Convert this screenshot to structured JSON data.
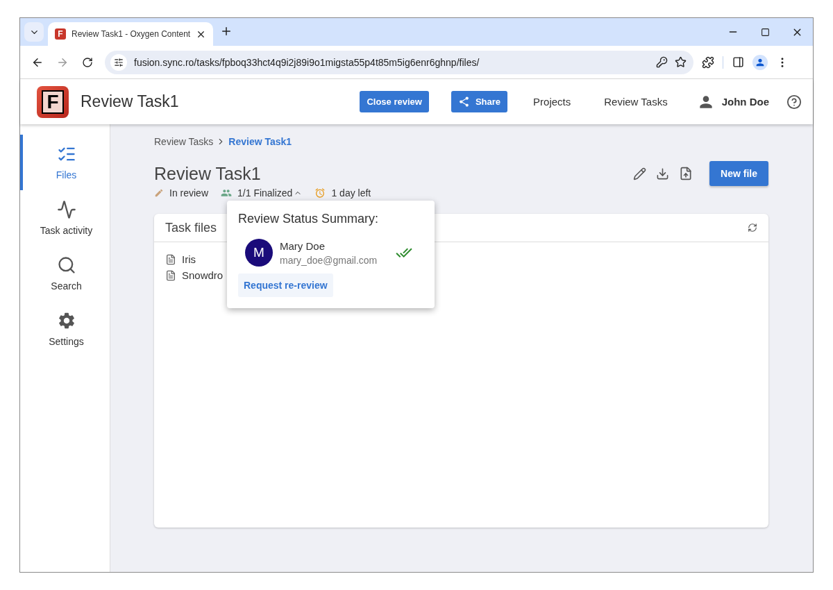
{
  "browser": {
    "favicon_letter": "F",
    "tab_title": "Review Task1 - Oxygen Content",
    "url": "fusion.sync.ro/tasks/fpboq33hct4q9i2j89i9o1migsta55p4t85m5ig6enr6ghnp/files/"
  },
  "header": {
    "logo_letter": "F",
    "app_title": "Review Task1",
    "buttons": [
      {
        "kind": "plain",
        "label": "Close review"
      },
      {
        "kind": "share",
        "label": "Share"
      }
    ],
    "links": [
      "Projects",
      "Review Tasks"
    ],
    "user": "John Doe"
  },
  "sidebar": {
    "items": [
      {
        "kind": "files",
        "label": "Files",
        "selected": true
      },
      {
        "kind": "activity",
        "label": "Task activity",
        "selected": false
      },
      {
        "kind": "search",
        "label": "Search",
        "selected": false
      },
      {
        "kind": "settings",
        "label": "Settings",
        "selected": false
      }
    ]
  },
  "breadcrumb": [
    {
      "label": "Review Tasks",
      "current": false
    },
    {
      "label": "Review Task1",
      "current": true
    }
  ],
  "title": "Review Task1",
  "status": [
    {
      "kind": "state",
      "text": "In review"
    },
    {
      "kind": "reviewers",
      "text": "1/1 Finalized",
      "expanded": true
    },
    {
      "kind": "deadline",
      "text": "1 day left"
    }
  ],
  "new_file_button": "New file",
  "task_files": {
    "title": "Task files",
    "files": [
      "Iris",
      "Snowdro"
    ]
  },
  "popover": {
    "title": "Review Status Summary:",
    "reviewers": [
      {
        "initial": "M",
        "name": "Mary Doe",
        "email": "mary_doe@gmail.com",
        "finalized": true
      }
    ],
    "action": "Request re-review"
  }
}
